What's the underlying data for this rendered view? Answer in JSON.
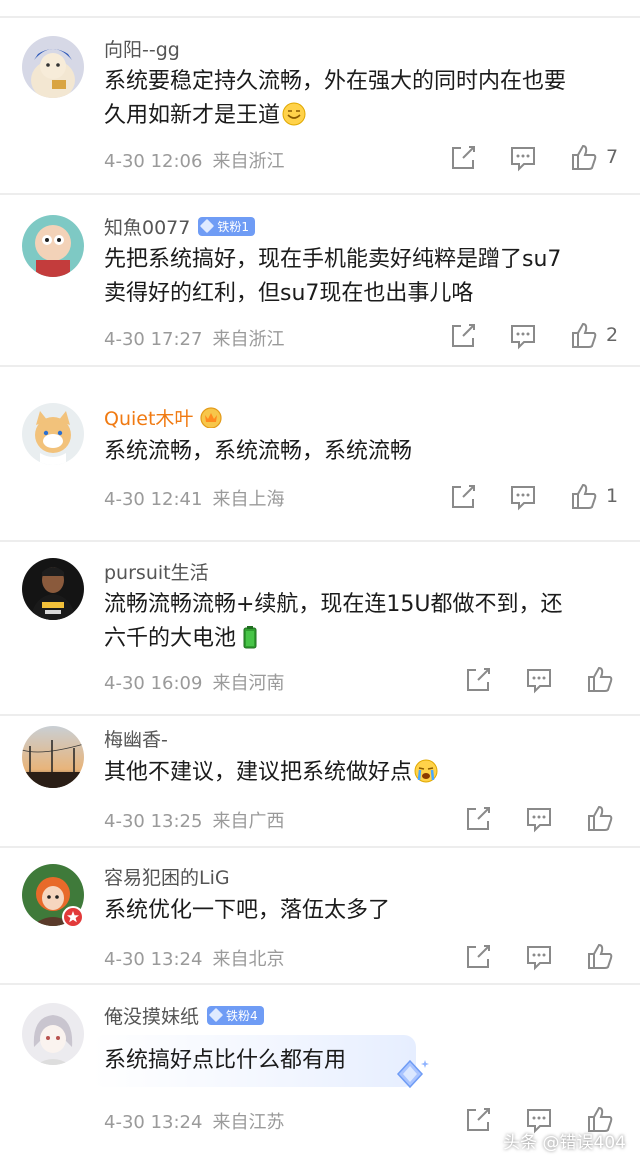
{
  "comments": [
    {
      "user": "向阳--gg",
      "text_line1": "系统要稳定持久流畅，外在强大的同时内在也要",
      "text_line2": "久用如新才是王道",
      "date": "4-30 12:06",
      "location": "来自浙江",
      "likes": "7",
      "emoji": "smile-face-emoji"
    },
    {
      "user": "知魚0077",
      "badge": "铁粉1",
      "text_line1": "先把系统搞好，现在手机能卖好纯粹是蹭了su7",
      "text_line2": "卖得好的红利，但su7现在也出事儿咯",
      "date": "4-30 17:27",
      "location": "来自浙江",
      "likes": "2"
    },
    {
      "user": "Quiet木叶",
      "text_line1": "系统流畅，系统流畅，系统流畅",
      "date": "4-30 12:41",
      "location": "来自上海",
      "likes": "1"
    },
    {
      "user": "pursuit生活",
      "text_line1": "流畅流畅流畅+续航，现在连15U都做不到，还",
      "text_line2": "六千的大电池",
      "date": "4-30 16:09",
      "location": "来自河南",
      "emoji": "battery-emoji"
    },
    {
      "user": "梅幽香-",
      "text_line1": "其他不建议，建议把系统做好点",
      "date": "4-30 13:25",
      "location": "来自广西",
      "emoji": "crying-face-emoji"
    },
    {
      "user": "容易犯困的LiG",
      "text_line1": "系统优化一下吧，落伍太多了",
      "date": "4-30 13:24",
      "location": "来自北京"
    },
    {
      "user": "俺没摸妹纸",
      "badge": "铁粉4",
      "text_line1": "系统搞好点比什么都有用",
      "date": "4-30 13:24",
      "location": "来自江苏"
    }
  ],
  "watermark": "头条 @错误404",
  "colors": {
    "username": "#555555",
    "vip_username": "#f07a12",
    "badge": "#6f9cf5",
    "meta": "#9a9a9a",
    "icon": "#8a8a8a"
  },
  "icons": {
    "share": "share-icon",
    "comment": "comment-icon",
    "like": "thumbs-up-icon"
  }
}
